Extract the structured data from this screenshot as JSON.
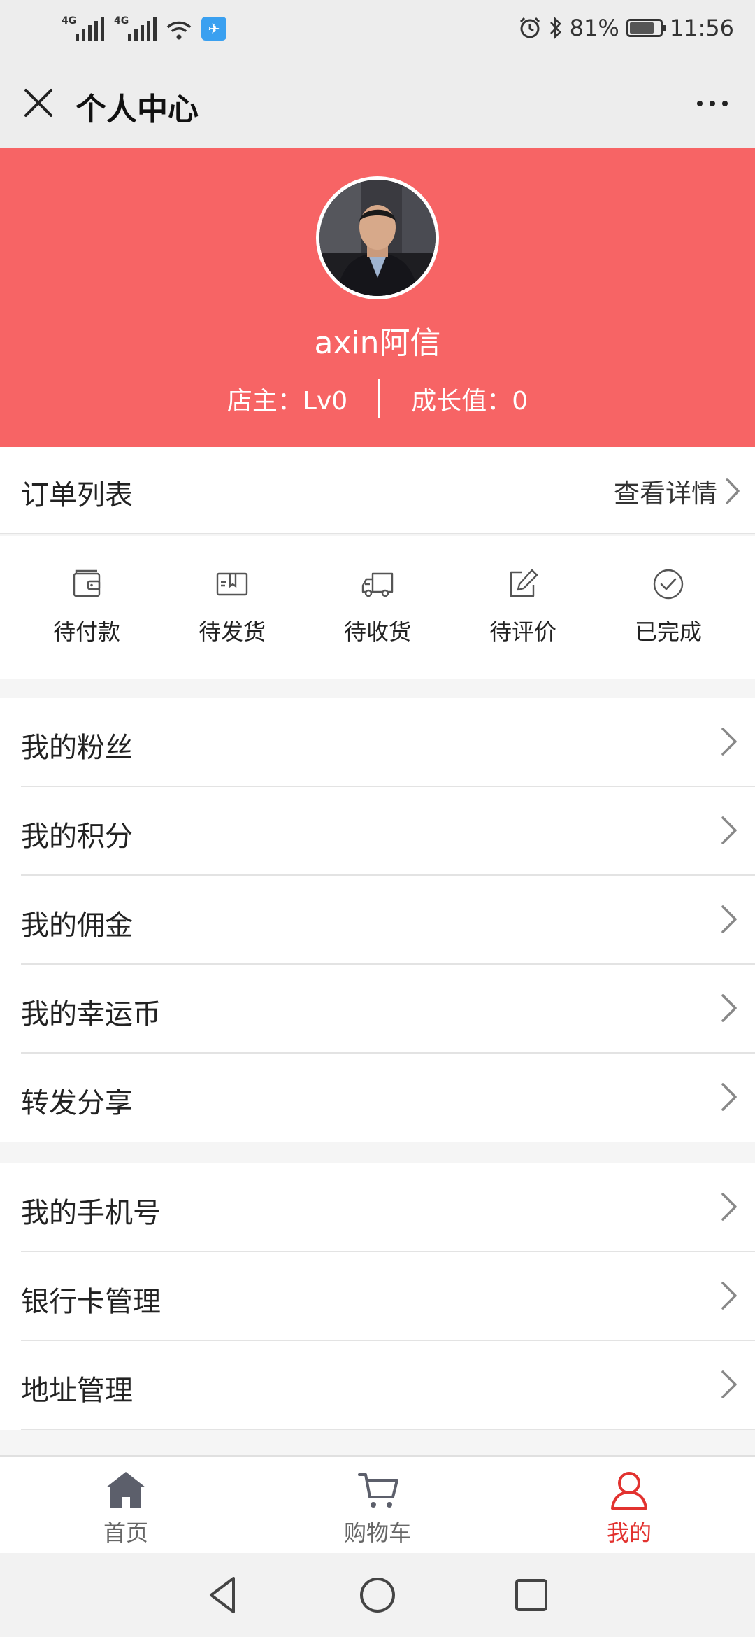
{
  "status_bar": {
    "network_1": "4G",
    "network_2": "4G",
    "battery_percent": "81%",
    "battery_level": 0.81,
    "time": "11:56"
  },
  "title_bar": {
    "title": "个人中心"
  },
  "profile": {
    "username": "axin阿信",
    "shop_level": "店主：Lv0",
    "growth_value": "成长值：0",
    "header_color": "#f76465"
  },
  "orders": {
    "title": "订单列表",
    "details_link": "查看详情",
    "statuses": [
      {
        "label": "待付款",
        "icon": "wallet-icon"
      },
      {
        "label": "待发货",
        "icon": "package-icon"
      },
      {
        "label": "待收货",
        "icon": "truck-icon"
      },
      {
        "label": "待评价",
        "icon": "edit-icon"
      },
      {
        "label": "已完成",
        "icon": "check-circle-icon"
      }
    ]
  },
  "menu_1": [
    {
      "label": "我的粉丝"
    },
    {
      "label": "我的积分"
    },
    {
      "label": "我的佣金"
    },
    {
      "label": "我的幸运币"
    },
    {
      "label": "转发分享"
    }
  ],
  "menu_2": [
    {
      "label": "我的手机号"
    },
    {
      "label": "银行卡管理"
    },
    {
      "label": "地址管理"
    }
  ],
  "tab_bar": {
    "tabs": [
      {
        "label": "首页",
        "icon": "home-icon",
        "active": false
      },
      {
        "label": "购物车",
        "icon": "cart-icon",
        "active": false
      },
      {
        "label": "我的",
        "icon": "user-icon",
        "active": true
      }
    ],
    "active_color": "#e2322f"
  }
}
